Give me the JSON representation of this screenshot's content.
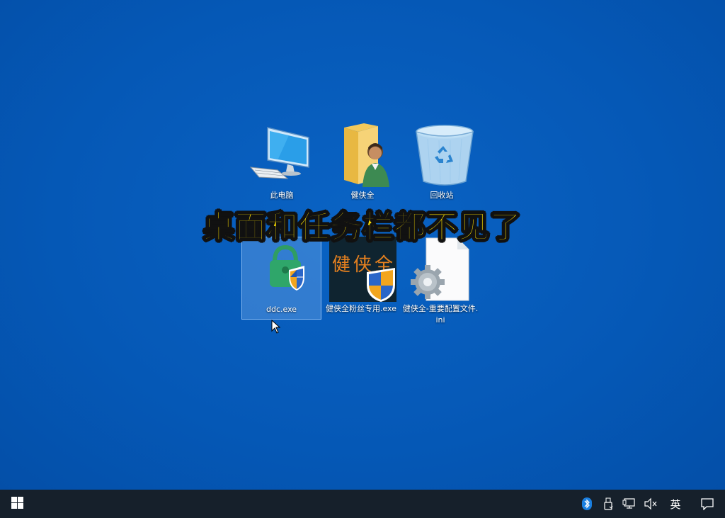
{
  "desktop": {
    "background_color": "#0559b8",
    "icons": [
      {
        "label": "此电脑",
        "icon": "this-pc-icon"
      },
      {
        "label": "健侠全",
        "icon": "user-folder-icon"
      },
      {
        "label": "回收站",
        "icon": "recycle-bin-icon"
      },
      {
        "label": "ddc.exe",
        "icon": "shield-app-icon",
        "selected": true
      },
      {
        "label": "健侠全粉丝专用.exe",
        "icon": "jianxiaquan-app-icon",
        "app_text": "健侠全"
      },
      {
        "label": "健侠全-重要配置文件.ini",
        "icon": "config-file-icon"
      }
    ]
  },
  "caption": "桌面和任务栏都不见了",
  "taskbar": {
    "background_color": "#16202b",
    "tray": {
      "ime_label": "英",
      "icons": [
        "bluetooth-icon",
        "usb-icon",
        "network-icon",
        "volume-muted-icon",
        "notification-icon"
      ]
    }
  }
}
